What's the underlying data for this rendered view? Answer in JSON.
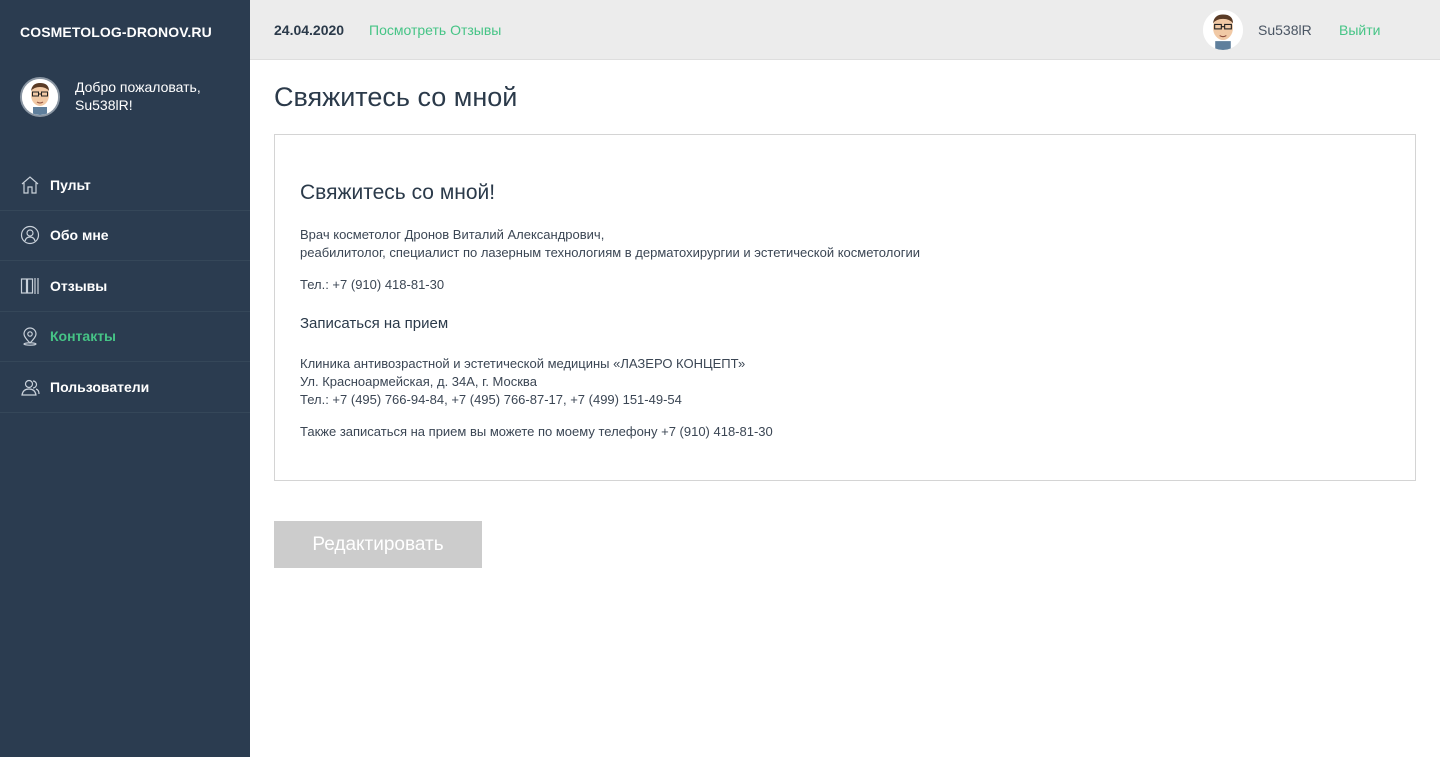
{
  "sidebar": {
    "brand": "COSMETOLOG-DRONOV.RU",
    "welcome_line1": "Добро пожаловать,",
    "welcome_line2": "Su538lR!",
    "items": [
      {
        "label": "Пульт",
        "icon": "home-icon"
      },
      {
        "label": "Обо мне",
        "icon": "user-circle-icon"
      },
      {
        "label": "Отзывы",
        "icon": "reviews-icon"
      },
      {
        "label": "Контакты",
        "icon": "location-pin-icon",
        "active": true
      },
      {
        "label": "Пользователи",
        "icon": "users-icon"
      }
    ]
  },
  "header": {
    "date": "24.04.2020",
    "reviews_link": "Посмотреть Отзывы",
    "username": "Su538lR",
    "logout": "Выйти"
  },
  "main": {
    "page_title": "Свяжитесь со мной",
    "card": {
      "title": "Свяжитесь со мной!",
      "intro_line1": "Врач косметолог Дронов Виталий Александрович,",
      "intro_line2": "реабилитолог, специалист по лазерным технологиям в дерматохирургии и эстетической косметологии",
      "phone": "Тел.: +7 (910) 418-81-30",
      "appointment_heading": "Записаться на прием",
      "clinic_line1": "Клиника антивозрастной и эстетической медицины «ЛАЗЕРО КОНЦЕПТ»",
      "clinic_line2": "Ул. Красноармейская, д. 34А, г. Москва",
      "clinic_line3": "Тел.: +7 (495) 766-94-84, +7 (495) 766-87-17, +7 (499) 151-49-54",
      "also_text": "Также записаться на прием вы можете по моему телефону +7 (910) 418-81-30"
    },
    "edit_button": "Редактировать"
  },
  "colors": {
    "sidebar_bg": "#2b3c50",
    "accent": "#46c486",
    "topbar_bg": "#ececec",
    "button_disabled": "#cccccc"
  }
}
